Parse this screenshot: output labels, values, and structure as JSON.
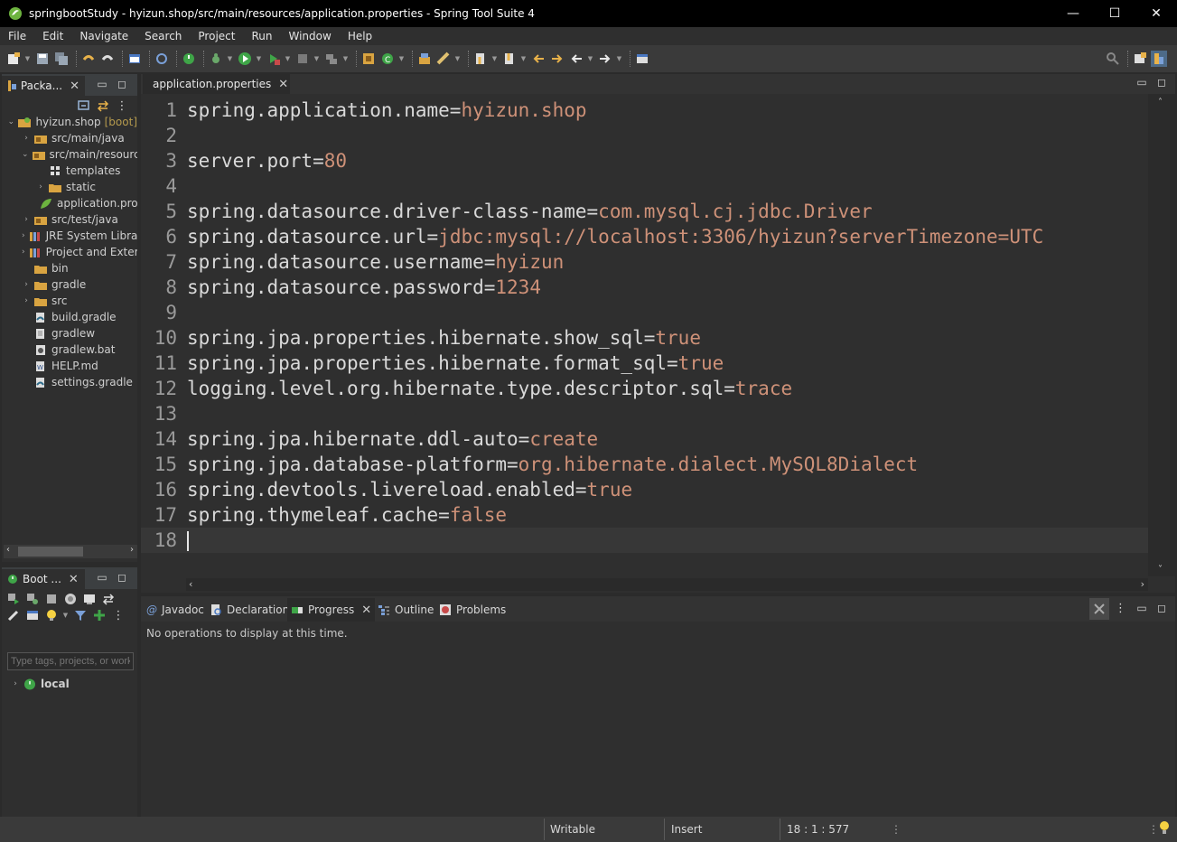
{
  "window": {
    "title": "springbootStudy - hyizun.shop/src/main/resources/application.properties - Spring Tool Suite 4",
    "controls": {
      "minimize": "—",
      "maximize": "☐",
      "close": "✕"
    }
  },
  "menu": [
    "File",
    "Edit",
    "Navigate",
    "Search",
    "Project",
    "Run",
    "Window",
    "Help"
  ],
  "package_explorer": {
    "tab_label": "Packa...",
    "project": {
      "name": "hyizun.shop",
      "tag": "[boot]"
    },
    "items": [
      {
        "label": "src/main/java",
        "icon": "source-folder-icon",
        "twisty": "›",
        "indent": 1
      },
      {
        "label": "src/main/resources",
        "icon": "source-folder-icon",
        "twisty": "⌄",
        "indent": 1
      },
      {
        "label": "templates",
        "icon": "package-icon",
        "twisty": "",
        "indent": 2
      },
      {
        "label": "static",
        "icon": "folder-icon",
        "twisty": "›",
        "indent": 2
      },
      {
        "label": "application.properties",
        "icon": "spring-leaf-icon",
        "twisty": "",
        "indent": 2
      },
      {
        "label": "src/test/java",
        "icon": "source-folder-icon",
        "twisty": "›",
        "indent": 1
      },
      {
        "label": "JRE System Library",
        "icon": "library-icon",
        "twisty": "›",
        "indent": 1
      },
      {
        "label": "Project and External Dependencies",
        "icon": "library-icon",
        "twisty": "›",
        "indent": 1
      },
      {
        "label": "bin",
        "icon": "folder-icon",
        "twisty": "",
        "indent": 1
      },
      {
        "label": "gradle",
        "icon": "folder-icon",
        "twisty": "›",
        "indent": 1
      },
      {
        "label": "src",
        "icon": "folder-icon",
        "twisty": "›",
        "indent": 1
      },
      {
        "label": "build.gradle",
        "icon": "gradle-file-icon",
        "twisty": "",
        "indent": 1
      },
      {
        "label": "gradlew",
        "icon": "file-icon",
        "twisty": "",
        "indent": 1
      },
      {
        "label": "gradlew.bat",
        "icon": "bat-file-icon",
        "twisty": "",
        "indent": 1
      },
      {
        "label": "HELP.md",
        "icon": "markdown-file-icon",
        "twisty": "",
        "indent": 1
      },
      {
        "label": "settings.gradle",
        "icon": "gradle-file-icon",
        "twisty": "",
        "indent": 1
      }
    ]
  },
  "boot_dashboard": {
    "tab_label": "Boot ...",
    "filter_placeholder": "Type tags, projects, or working set names to match",
    "items": [
      {
        "label": "local",
        "twisty": "›"
      }
    ]
  },
  "editor": {
    "tab_label": "application.properties",
    "lines": [
      {
        "n": "1",
        "key": "spring.application.name",
        "value": "hyizun.shop"
      },
      {
        "n": "2",
        "key": "",
        "value": ""
      },
      {
        "n": "3",
        "key": "server.port",
        "value": "80"
      },
      {
        "n": "4",
        "key": "",
        "value": ""
      },
      {
        "n": "5",
        "key": "spring.datasource.driver-class-name",
        "value": "com.mysql.cj.jdbc.Driver"
      },
      {
        "n": "6",
        "key": "spring.datasource.url",
        "value": "jdbc:mysql://localhost:3306/hyizun?serverTimezone=UTC"
      },
      {
        "n": "7",
        "key": "spring.datasource.username",
        "value": "hyizun"
      },
      {
        "n": "8",
        "key": "spring.datasource.password",
        "value": "1234"
      },
      {
        "n": "9",
        "key": "",
        "value": ""
      },
      {
        "n": "10",
        "key": "spring.jpa.properties.hibernate.show_sql",
        "value": "true"
      },
      {
        "n": "11",
        "key": "spring.jpa.properties.hibernate.format_sql",
        "value": "true"
      },
      {
        "n": "12",
        "key": "logging.level.org.hibernate.type.descriptor.sql",
        "value": "trace"
      },
      {
        "n": "13",
        "key": "",
        "value": ""
      },
      {
        "n": "14",
        "key": "spring.jpa.hibernate.ddl-auto",
        "value": "create"
      },
      {
        "n": "15",
        "key": "spring.jpa.database-platform",
        "value": "org.hibernate.dialect.MySQL8Dialect"
      },
      {
        "n": "16",
        "key": "spring.devtools.livereload.enabled",
        "value": "true"
      },
      {
        "n": "17",
        "key": "spring.thymeleaf.cache",
        "value": "false"
      },
      {
        "n": "18",
        "key": "",
        "value": ""
      }
    ],
    "current_line": "18"
  },
  "bottom_panel": {
    "tabs": [
      {
        "label": "Javadoc",
        "icon": "javadoc-icon"
      },
      {
        "label": "Declaration",
        "icon": "declaration-icon"
      },
      {
        "label": "Progress",
        "icon": "progress-icon",
        "active": true
      },
      {
        "label": "Outline",
        "icon": "outline-icon"
      },
      {
        "label": "Problems",
        "icon": "problems-icon"
      }
    ],
    "message": "No operations to display at this time."
  },
  "status_bar": {
    "writable": "Writable",
    "insert_mode": "Insert",
    "position": "18 : 1 : 577"
  },
  "colors": {
    "background": "#2b2b2b",
    "property_value": "#ce9178",
    "property_key": "#d9d9d9",
    "line_number": "#9a9a9a",
    "spring_green": "#6db33f"
  }
}
